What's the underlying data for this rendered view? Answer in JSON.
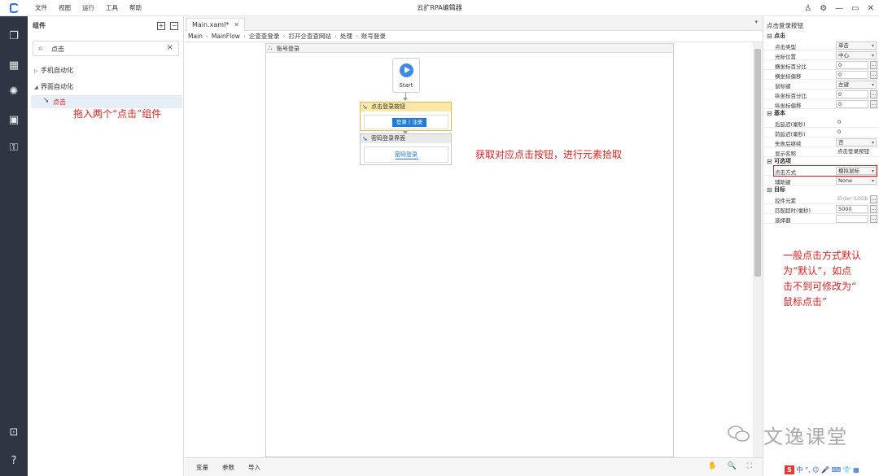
{
  "app": {
    "title": "云扩RPA编辑器"
  },
  "menu": [
    "文件",
    "视图",
    "运行",
    "工具",
    "帮助"
  ],
  "window_controls": {
    "user": "♙",
    "settings": "⚙",
    "minimize": "—",
    "restore": "▭",
    "close": "✕"
  },
  "left_panel": {
    "title": "组件",
    "expand_all": "+",
    "collapse_all": "−",
    "search": {
      "value": "点击",
      "placeholder": "搜索"
    },
    "tree": [
      {
        "label": "手机自动化",
        "expanded": false
      },
      {
        "label": "界面自动化",
        "expanded": true
      },
      {
        "label": "点击",
        "selected": true
      }
    ]
  },
  "annotations": {
    "drag_hint": "拖入两个“点击”组件",
    "pick_hint": "获取对应点击按钮，进行元素拾取",
    "method_hint": "一般点击方式默认\n为“默认”，如点\n击不到可修改为“\n鼠标点击”"
  },
  "editor": {
    "tab": "Main.xaml*",
    "breadcrumb": [
      "Main",
      "MainFlow",
      "企查查登录",
      "打开企查查网站",
      "处理",
      "账号登录"
    ],
    "sequence_title": "账号登录",
    "start_label": "Start",
    "activity1": {
      "title": "点击登录按钮",
      "preview_text": "登录 | 注册"
    },
    "activity2": {
      "title": "密码登录界面",
      "preview_text": "密码登录"
    },
    "bottom_tabs": [
      "变量",
      "参数",
      "导入"
    ],
    "bottom_tools": "✋ 🔍 ⛶"
  },
  "properties": {
    "title": "点击登录按钮",
    "sections": [
      {
        "name": "点击",
        "rows": [
          {
            "key": "点击类型",
            "value": "单击",
            "type": "dropdown"
          },
          {
            "key": "光标位置",
            "value": "中心",
            "type": "dropdown"
          },
          {
            "key": "横坐标百分比",
            "value": "0",
            "type": "text",
            "edit": true
          },
          {
            "key": "横坐标偏移",
            "value": "0",
            "type": "text",
            "edit": true
          },
          {
            "key": "鼠标键",
            "value": "左键",
            "type": "dropdown"
          },
          {
            "key": "纵坐标百分比",
            "value": "0",
            "type": "text",
            "edit": true
          },
          {
            "key": "纵坐标偏移",
            "value": "0",
            "type": "text",
            "edit": true
          }
        ]
      },
      {
        "name": "基本",
        "rows": [
          {
            "key": "后延迟(毫秒)",
            "value": "0",
            "type": "plain"
          },
          {
            "key": "前延迟(毫秒)",
            "value": "0",
            "type": "plain"
          },
          {
            "key": "失败后继续",
            "value": "否",
            "type": "dropdown"
          },
          {
            "key": "显示名称",
            "value": "点击登录按钮",
            "type": "plain"
          }
        ]
      },
      {
        "name": "可选项",
        "rows": [
          {
            "key": "点击方式",
            "value": "模拟鼠标",
            "type": "dropdown"
          },
          {
            "key": "辅助键",
            "value": "None",
            "type": "dropdown"
          }
        ]
      },
      {
        "name": "目标",
        "rows": [
          {
            "key": "控件元素",
            "value": "Enter IUIOb",
            "type": "placeholder",
            "edit": true
          },
          {
            "key": "匹配超时(毫秒)",
            "value": "5000",
            "type": "text",
            "edit": true
          },
          {
            "key": "选择器",
            "value": "",
            "type": "text",
            "edit": true
          }
        ]
      }
    ]
  },
  "watermark": "文逸课堂",
  "ime_bar": "中 °, ☺ 🎤 ⌨ 👕 ▦"
}
